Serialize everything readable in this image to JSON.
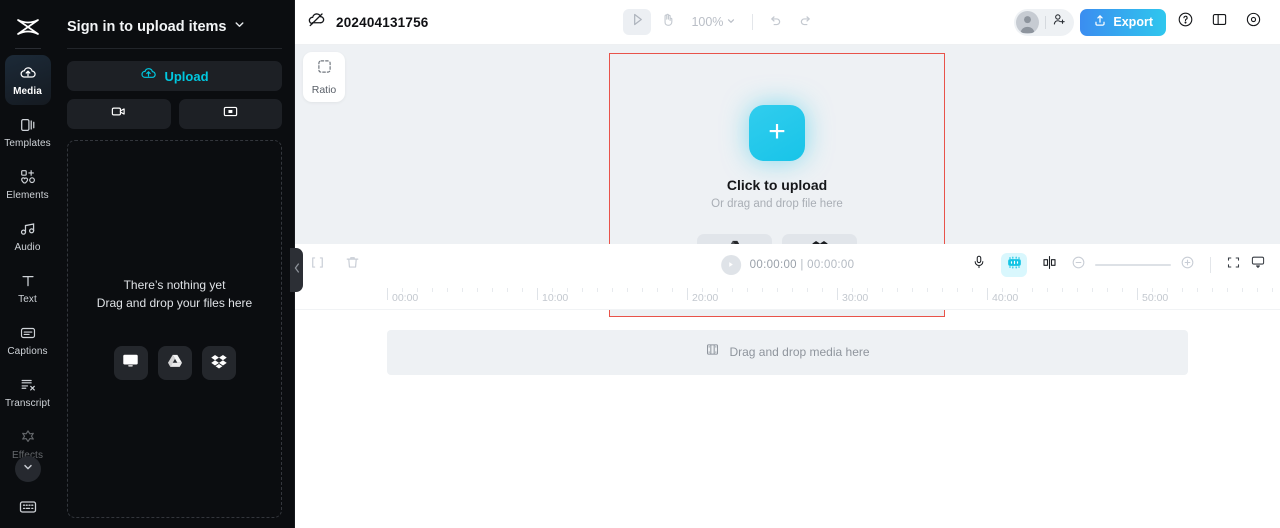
{
  "rail": {
    "logo_icon": "capcut-logo-icon",
    "items": [
      {
        "label": "Media",
        "icon": "cloud-upload-icon",
        "active": true
      },
      {
        "label": "Templates",
        "icon": "templates-icon",
        "active": false
      },
      {
        "label": "Elements",
        "icon": "elements-icon",
        "active": false
      },
      {
        "label": "Audio",
        "icon": "audio-note-icon",
        "active": false
      },
      {
        "label": "Text",
        "icon": "text-t-icon",
        "active": false
      },
      {
        "label": "Captions",
        "icon": "captions-icon",
        "active": false
      },
      {
        "label": "Transcript",
        "icon": "transcript-icon",
        "active": false
      },
      {
        "label": "Effects",
        "icon": "effects-star-icon",
        "active": false
      }
    ],
    "expand_icon": "chevron-down-icon",
    "keyboard_icon": "keyboard-icon"
  },
  "panel": {
    "title": "Sign in to upload items",
    "title_chevron": "chevron-down-icon",
    "upload_label": "Upload",
    "upload_icon": "cloud-upload-icon",
    "record_video_icon": "video-camera-icon",
    "record_screen_icon": "screen-record-icon",
    "empty_line1": "There’s nothing yet",
    "empty_line2": "Drag and drop your files here",
    "sources": [
      {
        "name": "device",
        "icon": "monitor-icon"
      },
      {
        "name": "google-drive",
        "icon": "google-drive-icon"
      },
      {
        "name": "dropbox",
        "icon": "dropbox-icon"
      }
    ],
    "collapse_icon": "chevron-left-icon"
  },
  "topbar": {
    "project_icon": "cloud-offline-icon",
    "project_name": "202404131756",
    "select_tool_icon": "cursor-arrow-icon",
    "hand_tool_icon": "hand-icon",
    "zoom_level": "100%",
    "zoom_chevron": "chevron-down-icon",
    "undo_icon": "undo-icon",
    "redo_icon": "redo-icon",
    "avatar_icon": "user-avatar-icon",
    "invite_icon": "add-person-icon",
    "export_label": "Export",
    "export_icon": "export-upload-icon",
    "help_icon": "question-circle-icon",
    "layout_icon": "panel-layout-icon",
    "settings_icon": "settings-gear-icon"
  },
  "canvas": {
    "ratio_label": "Ratio",
    "ratio_icon": "dashed-square-icon",
    "plus_icon": "plus-icon",
    "upload_title": "Click to upload",
    "upload_sub": "Or drag and drop file here",
    "buttons": [
      {
        "name": "google-drive",
        "icon": "google-drive-icon"
      },
      {
        "name": "dropbox",
        "icon": "dropbox-icon"
      }
    ],
    "border_color": "#e8534a",
    "accent_color": "#22c8e8"
  },
  "timeline": {
    "split_icon": "split-clip-icon",
    "delete_icon": "trash-icon",
    "play_icon": "play-icon",
    "current_time": "00:00:00",
    "time_separator": "|",
    "total_time": "00:00:00",
    "mic_icon": "microphone-icon",
    "autocut_icon": "auto-cut-icon",
    "mirror_icon": "mirror-split-icon",
    "zoom_out_icon": "minus-circle-icon",
    "zoom_in_icon": "plus-circle-icon",
    "fit_icon": "fit-screen-icon",
    "preview_icon": "preview-monitor-icon",
    "ruler_labels": [
      "00:00",
      "10:00",
      "20:00",
      "30:00",
      "40:00",
      "50:00"
    ],
    "track_placeholder": "Drag and drop media here",
    "track_icon": "film-strip-icon"
  }
}
